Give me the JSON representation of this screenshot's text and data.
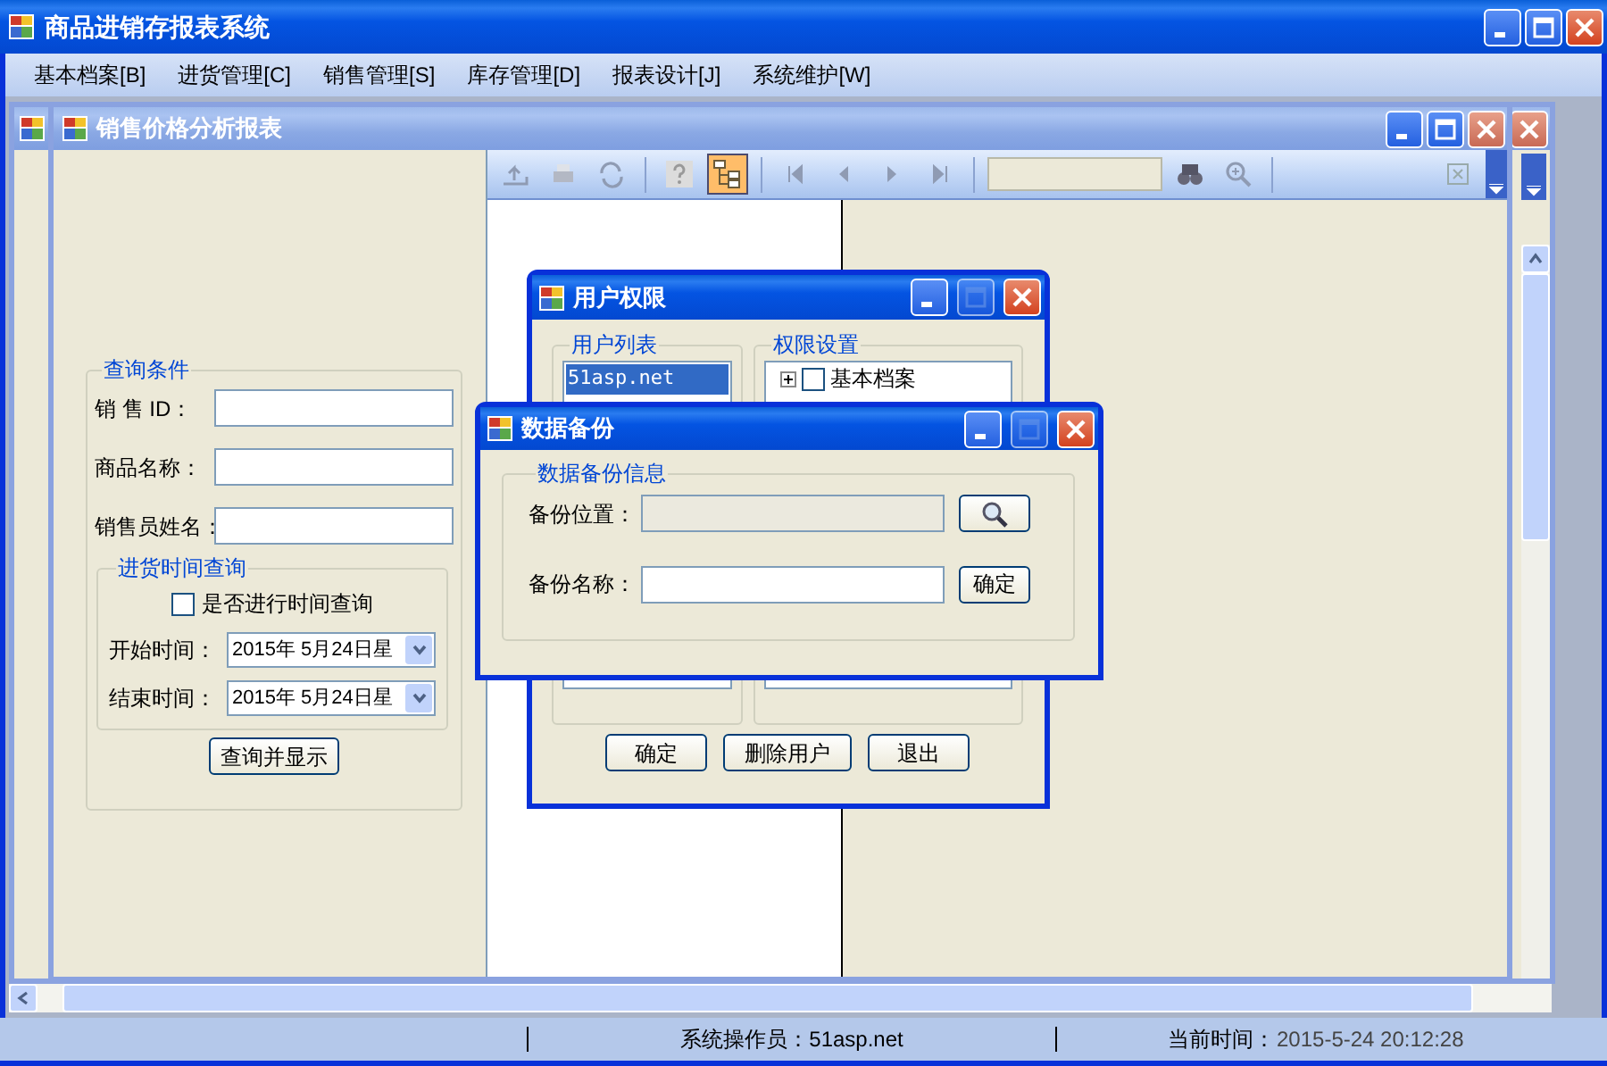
{
  "window": {
    "title": "商品进销存报表系统"
  },
  "menu": [
    "基本档案[B]",
    "进货管理[C]",
    "销售管理[S]",
    "库存管理[D]",
    "报表设计[J]",
    "系统维护[W]"
  ],
  "child_window": {
    "title": "销售价格分析报表"
  },
  "query": {
    "title": "查询条件",
    "fields": [
      {
        "label": "销 售 ID："
      },
      {
        "label": "商品名称："
      },
      {
        "label": "销售员姓名："
      }
    ],
    "time_group": {
      "title": "进货时间查询",
      "checkbox": {
        "label": "是否进行时间查询",
        "checked": false
      },
      "dates": [
        {
          "label": "开始时间：",
          "value": "2015年 5月24日星"
        },
        {
          "label": "结束时间：",
          "value": "2015年 5月24日星"
        }
      ]
    },
    "button": "查询并显示"
  },
  "report_viewer": {
    "group_tree_on": true
  },
  "user_dialog": {
    "title": "用户权限",
    "maximize_enabled": false,
    "user_list": {
      "title": "用户列表",
      "items": [
        {
          "label": "51asp.net",
          "selected": true
        }
      ]
    },
    "permissions": {
      "title": "权限设置",
      "items": [
        {
          "label": "基本档案",
          "checked": false,
          "expanded": false
        }
      ]
    },
    "buttons": [
      "确定",
      "删除用户",
      "退出"
    ]
  },
  "backup_dialog": {
    "title": "数据备份",
    "maximize_enabled": false,
    "group_title": "数据备份信息",
    "location": {
      "label": "备份位置：",
      "disabled": true
    },
    "name": {
      "label": "备份名称：",
      "disabled": false
    },
    "confirm": "确定"
  },
  "status_bar": {
    "operator": "系统操作员：51asp.net",
    "time_label": "当前时间：",
    "time": "2015-5-24 20:12:28"
  }
}
